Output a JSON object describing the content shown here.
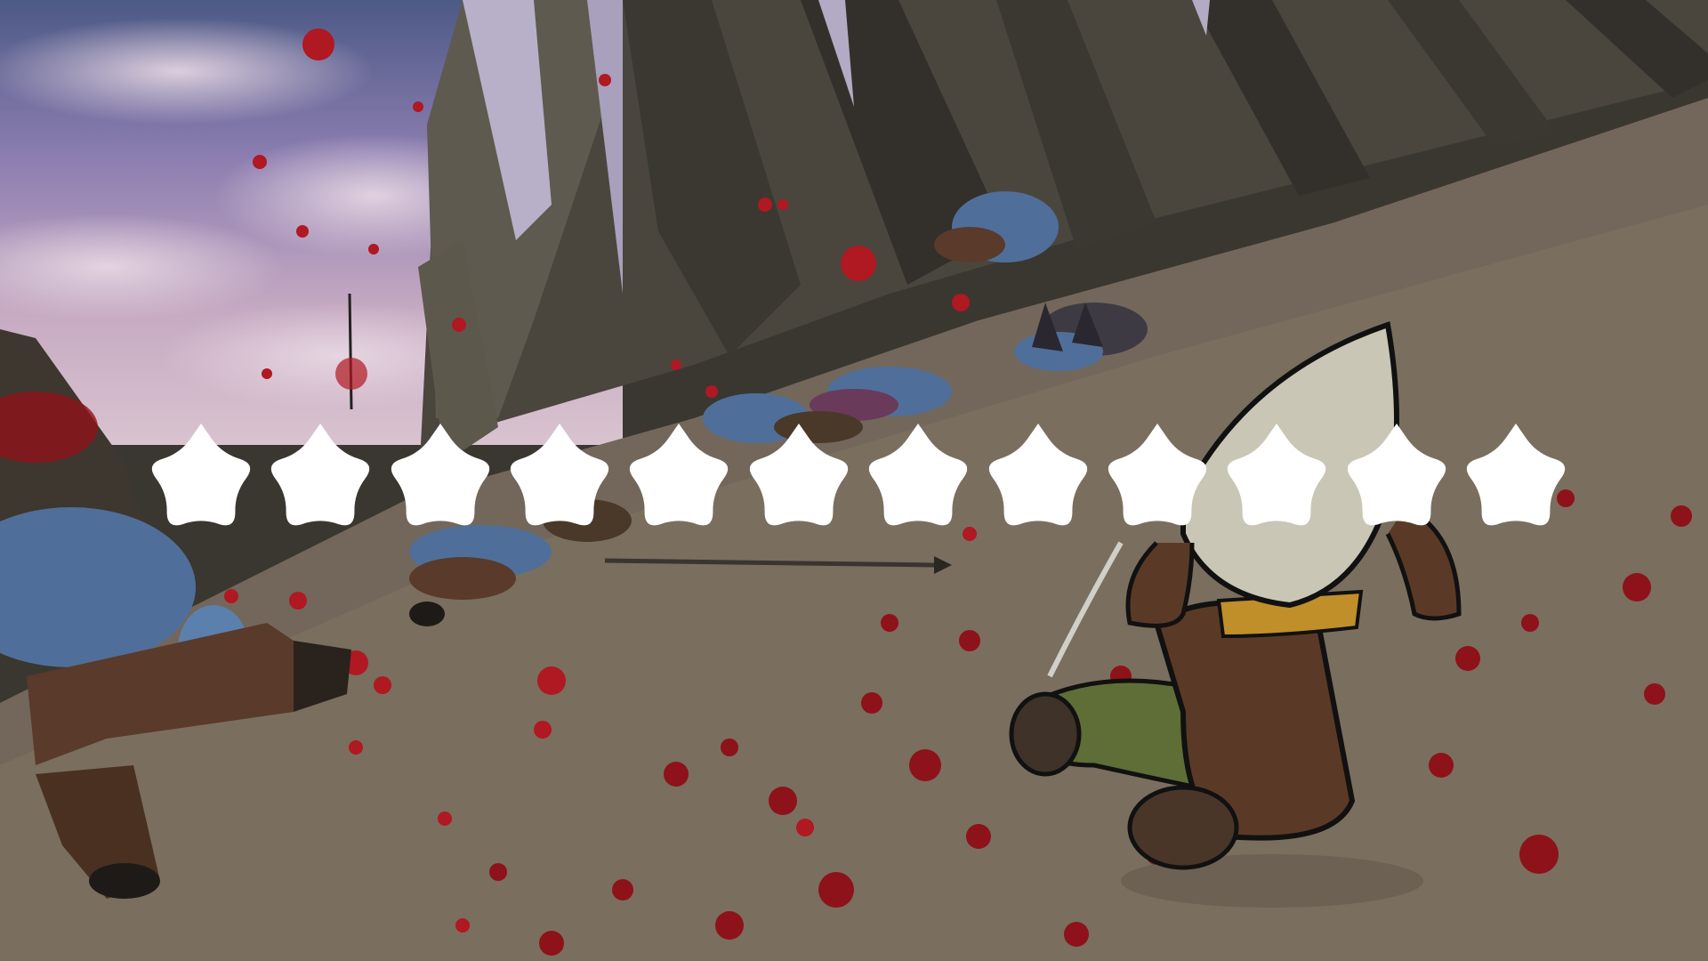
{
  "scene": {
    "description_free": true,
    "sky_colors": [
      "#5a5a8c",
      "#8a7fb0",
      "#c9b7c6",
      "#e8d8e0"
    ],
    "ground_color": "#6e6352",
    "wall_color": "#45413a",
    "blood_color": "#a3141b",
    "enemy_skin_color": "#4f6f9a",
    "player_pants_color": "#5e6e36",
    "player_hood_color": "#c9c6b6"
  },
  "hud": {
    "star_count": 12,
    "star_color": "#ffffff",
    "star_icon": "flower-star-icon"
  }
}
